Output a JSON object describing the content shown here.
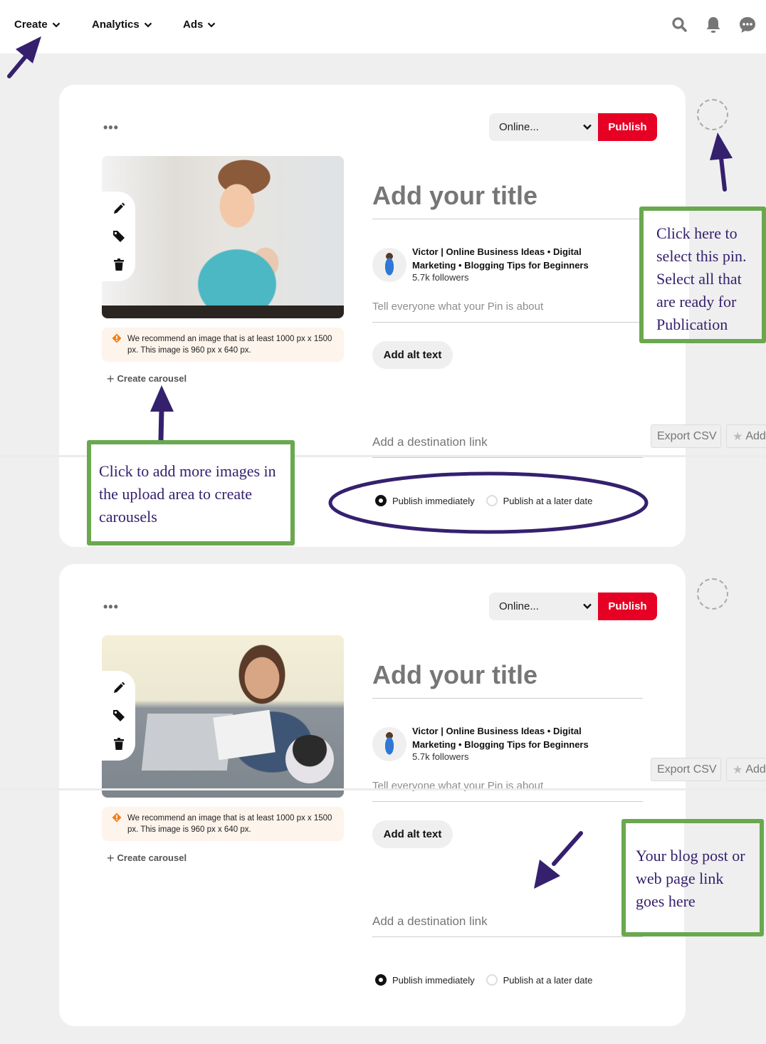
{
  "topnav": {
    "items": [
      {
        "label": "Create"
      },
      {
        "label": "Analytics"
      },
      {
        "label": "Ads"
      }
    ],
    "icons": [
      "search-icon",
      "bell-icon",
      "chat-icon"
    ]
  },
  "pins": [
    {
      "more_label": "•••",
      "board_select": "Online...",
      "publish_label": "Publish",
      "image_desc": "Woman holding baby at laptop",
      "warning": "We recommend an image that is at least 1000 px x 1500 px. This image is 960 px x 640 px.",
      "create_carousel": "Create carousel",
      "title_placeholder": "Add your title",
      "profile_name": "Victor | Online Business Ideas • Digital Marketing • Blogging Tips for Beginners",
      "followers": "5.7k followers",
      "description_placeholder": "Tell everyone what your Pin is about",
      "alt_text_label": "Add alt text",
      "link_placeholder": "Add a destination link",
      "publish_options": [
        {
          "label": "Publish immediately",
          "selected": true
        },
        {
          "label": "Publish at a later date",
          "selected": false
        }
      ]
    },
    {
      "more_label": "•••",
      "board_select": "Online...",
      "publish_label": "Publish",
      "image_desc": "Woman on phone reading papers on sofa",
      "warning": "We recommend an image that is at least 1000 px x 1500 px. This image is 960 px x 640 px.",
      "create_carousel": "Create carousel",
      "title_placeholder": "Add your title",
      "profile_name": "Victor | Online Business Ideas • Digital Marketing • Blogging Tips for Beginners",
      "followers": "5.7k followers",
      "description_placeholder": "Tell everyone what your Pin is about",
      "alt_text_label": "Add alt text",
      "link_placeholder": "Add a destination link",
      "publish_options": [
        {
          "label": "Publish immediately",
          "selected": true
        },
        {
          "label": "Publish at a later date",
          "selected": false
        }
      ]
    }
  ],
  "extension_buttons": {
    "export_csv": "Export CSV",
    "add": "Add"
  },
  "annotations": {
    "select_pin": "Click here to select this pin. Select all that are ready for Publication",
    "carousel": "Click to add more images in the upload area to create carousels",
    "link": "Your blog post or web page link goes here"
  },
  "colors": {
    "publish_red": "#e60023",
    "annotation_green": "#6aa84f",
    "annotation_purple": "#35206e",
    "background": "#efefef"
  }
}
